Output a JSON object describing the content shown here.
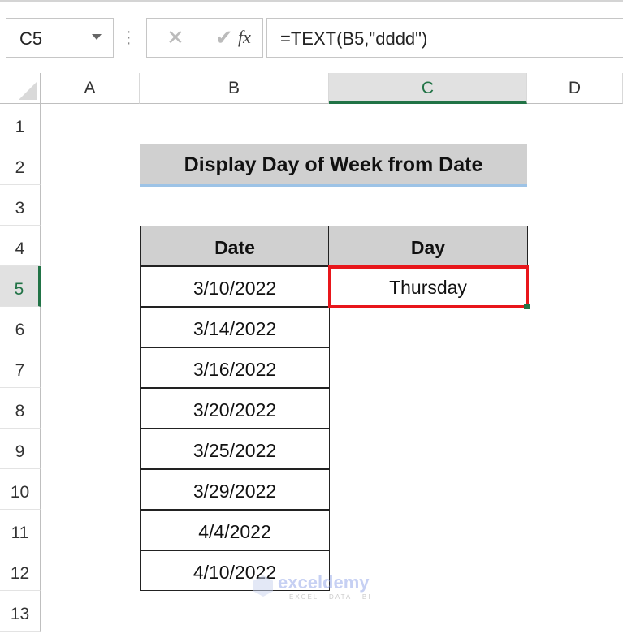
{
  "name_box": "C5",
  "formula_bar": {
    "cancel_icon": "x-icon",
    "enter_icon": "check-icon",
    "fx_label": "fx",
    "formula": "=TEXT(B5,\"dddd\")"
  },
  "columns": [
    "A",
    "B",
    "C",
    "D"
  ],
  "rows": [
    "1",
    "2",
    "3",
    "4",
    "5",
    "6",
    "7",
    "8",
    "9",
    "10",
    "11",
    "12",
    "13"
  ],
  "selected_cell": "C5",
  "title": "Display Day of Week from Date",
  "table": {
    "headers": [
      "Date",
      "Day"
    ],
    "rows": [
      [
        "3/10/2022",
        "Thursday"
      ],
      [
        "3/14/2022",
        ""
      ],
      [
        "3/16/2022",
        ""
      ],
      [
        "3/20/2022",
        ""
      ],
      [
        "3/25/2022",
        ""
      ],
      [
        "3/29/2022",
        ""
      ],
      [
        "4/4/2022",
        ""
      ],
      [
        "4/10/2022",
        ""
      ]
    ]
  },
  "watermark": {
    "name": "exceldemy",
    "tagline": "EXCEL · DATA · BI"
  },
  "colors": {
    "accent": "#217346",
    "highlight": "#e8161b",
    "header_fill": "#d0d0d0"
  }
}
